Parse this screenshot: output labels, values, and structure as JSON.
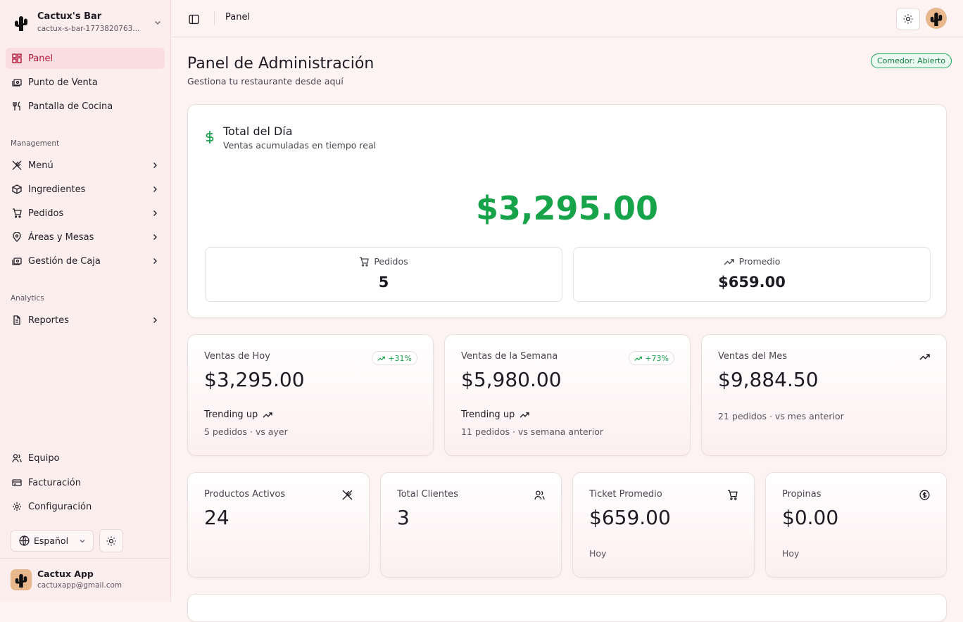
{
  "org": {
    "name": "Cactux's Bar",
    "slug": "cactux-s-bar-1773820763..."
  },
  "nav": {
    "main": [
      {
        "label": "Panel",
        "icon": "grid-icon",
        "active": true
      },
      {
        "label": "Punto de Venta",
        "icon": "register-icon"
      },
      {
        "label": "Pantalla de Cocina",
        "icon": "utensils-icon"
      }
    ],
    "management_label": "Management",
    "management": [
      {
        "label": "Menú",
        "icon": "utensils-crossed-icon"
      },
      {
        "label": "Ingredientes",
        "icon": "package-icon"
      },
      {
        "label": "Pedidos",
        "icon": "cart-icon"
      },
      {
        "label": "Áreas y Mesas",
        "icon": "map-pin-icon"
      },
      {
        "label": "Gestión de Caja",
        "icon": "register-icon"
      }
    ],
    "analytics_label": "Analytics",
    "analytics": [
      {
        "label": "Reportes",
        "icon": "file-icon"
      }
    ],
    "bottom": [
      {
        "label": "Equipo",
        "icon": "users-icon"
      },
      {
        "label": "Facturación",
        "icon": "credit-card-icon"
      },
      {
        "label": "Configuración",
        "icon": "gear-icon"
      }
    ]
  },
  "language": {
    "selected": "Español"
  },
  "user": {
    "name": "Cactux App",
    "email": "cactuxapp@gmail.com"
  },
  "topbar": {
    "breadcrumb": "Panel"
  },
  "page": {
    "title": "Panel de Administración",
    "subtitle": "Gestiona tu restaurante desde aquí",
    "status": "Comedor: Abierto"
  },
  "total": {
    "title": "Total del Día",
    "subtitle": "Ventas acumuladas en tiempo real",
    "amount": "$3,295.00",
    "orders_label": "Pedidos",
    "orders_value": "5",
    "avg_label": "Promedio",
    "avg_value": "$659.00"
  },
  "stats": {
    "today": {
      "label": "Ventas de Hoy",
      "value": "$3,295.00",
      "badge": "+31%",
      "trend": "Trending up",
      "foot": "5 pedidos · vs ayer"
    },
    "week": {
      "label": "Ventas de la Semana",
      "value": "$5,980.00",
      "badge": "+73%",
      "trend": "Trending up",
      "foot": "11 pedidos · vs semana anterior"
    },
    "month": {
      "label": "Ventas del Mes",
      "value": "$9,884.50",
      "foot": "21 pedidos · vs mes anterior"
    }
  },
  "kpis": {
    "products": {
      "label": "Productos Activos",
      "value": "24"
    },
    "clients": {
      "label": "Total Clientes",
      "value": "3"
    },
    "ticket": {
      "label": "Ticket Promedio",
      "value": "$659.00",
      "foot": "Hoy"
    },
    "tips": {
      "label": "Propinas",
      "value": "$0.00",
      "foot": "Hoy"
    }
  },
  "colors": {
    "accent": "#b2193b",
    "success": "#16a34a",
    "sidebar_bg": "#fdeeee"
  }
}
